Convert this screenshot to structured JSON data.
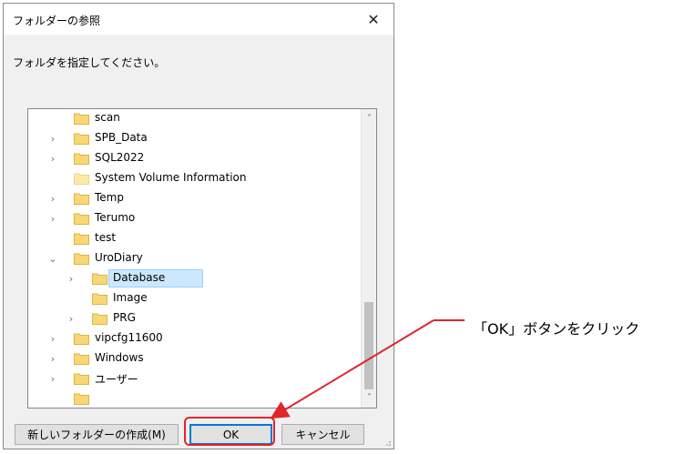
{
  "dialog": {
    "title": "フォルダーの参照",
    "close_glyph": "✕",
    "instruction": "フォルダを指定してください。"
  },
  "tree": {
    "items": [
      {
        "label": "scan",
        "level": 1,
        "expander": "",
        "folder_style": "normal"
      },
      {
        "label": "SPB_Data",
        "level": 1,
        "expander": "›",
        "folder_style": "normal"
      },
      {
        "label": "SQL2022",
        "level": 1,
        "expander": "›",
        "folder_style": "normal"
      },
      {
        "label": "System Volume Information",
        "level": 1,
        "expander": "",
        "folder_style": "light"
      },
      {
        "label": "Temp",
        "level": 1,
        "expander": "›",
        "folder_style": "normal"
      },
      {
        "label": "Terumo",
        "level": 1,
        "expander": "›",
        "folder_style": "normal"
      },
      {
        "label": "test",
        "level": 1,
        "expander": "",
        "folder_style": "normal"
      },
      {
        "label": "UroDiary",
        "level": 1,
        "expander": "⌄",
        "folder_style": "normal"
      },
      {
        "label": "Database",
        "level": 2,
        "expander": "›",
        "folder_style": "normal",
        "selected": true
      },
      {
        "label": "Image",
        "level": 2,
        "expander": "",
        "folder_style": "normal"
      },
      {
        "label": "PRG",
        "level": 2,
        "expander": "›",
        "folder_style": "normal"
      },
      {
        "label": "vipcfg11600",
        "level": 1,
        "expander": "›",
        "folder_style": "normal"
      },
      {
        "label": "Windows",
        "level": 1,
        "expander": "›",
        "folder_style": "normal"
      },
      {
        "label": "ユーザー",
        "level": 1,
        "expander": "›",
        "folder_style": "normal"
      },
      {
        "label": "",
        "level": 1,
        "expander": "",
        "folder_style": "normal",
        "partial": true
      }
    ],
    "scroll_up": "˄",
    "scroll_down": "˅"
  },
  "buttons": {
    "new_folder": "新しいフォルダーの作成(M)",
    "ok": "OK",
    "cancel": "キャンセル"
  },
  "annotation": {
    "callout": "「OK」ボタンをクリック",
    "color": "#e0252c"
  },
  "colors": {
    "folder": "#f8d775",
    "selection": "#cce8ff",
    "accent": "#0078d7"
  }
}
